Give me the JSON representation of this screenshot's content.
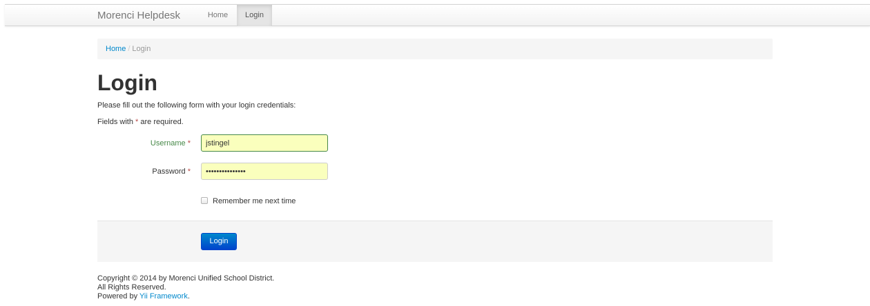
{
  "navbar": {
    "brand": "Morenci Helpdesk",
    "items": [
      {
        "label": "Home",
        "active": false
      },
      {
        "label": "Login",
        "active": true
      }
    ]
  },
  "breadcrumb": {
    "home": "Home",
    "separator": "/",
    "current": "Login"
  },
  "page": {
    "title": "Login",
    "intro": "Please fill out the following form with your login credentials:",
    "required_prefix": "Fields with ",
    "required_mark": "*",
    "required_suffix": " are required."
  },
  "form": {
    "username": {
      "label": "Username",
      "required_mark": "*",
      "value": "jstingel"
    },
    "password": {
      "label": "Password",
      "required_mark": "*",
      "value": "•••••••••••••••"
    },
    "remember_label": "Remember me next time",
    "remember_checked": false,
    "submit_label": "Login"
  },
  "footer": {
    "copyright": "Copyright © 2014 by Morenci Unified School District.",
    "rights": "All Rights Reserved.",
    "powered_prefix": "Powered by ",
    "powered_link": "Yii Framework",
    "powered_suffix": "."
  },
  "colors": {
    "accent": "#0088cc",
    "success_label": "#468847",
    "required": "#b94a48",
    "autofill": "#faffbd"
  }
}
